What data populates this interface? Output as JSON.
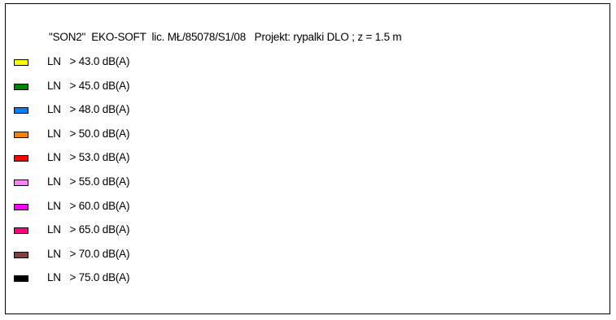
{
  "legend": {
    "title": "\"SON2\"  EKO-SOFT  lic. MŁ/85078/S1/08   Projekt: rypalki DLO ; z = 1.5 m",
    "items": [
      {
        "label": "LN   > 43.0 dB(A)",
        "color": "#ffff00"
      },
      {
        "label": "LN   > 45.0 dB(A)",
        "color": "#008000"
      },
      {
        "label": "LN   > 48.0 dB(A)",
        "color": "#0080ff"
      },
      {
        "label": "LN   > 50.0 dB(A)",
        "color": "#ff8000"
      },
      {
        "label": "LN   > 53.0 dB(A)",
        "color": "#ff0000"
      },
      {
        "label": "LN   > 55.0 dB(A)",
        "color": "#ff80ff"
      },
      {
        "label": "LN   > 60.0 dB(A)",
        "color": "#ff00ff"
      },
      {
        "label": "LN   > 65.0 dB(A)",
        "color": "#ff0080"
      },
      {
        "label": "LN   > 70.0 dB(A)",
        "color": "#804040"
      },
      {
        "label": "LN   > 75.0 dB(A)",
        "color": "#000000"
      }
    ]
  }
}
